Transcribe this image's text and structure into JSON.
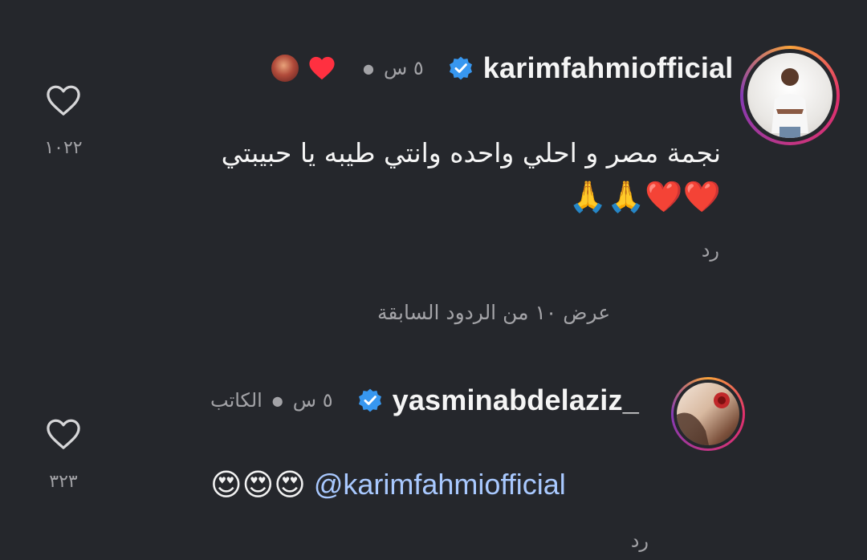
{
  "comments": [
    {
      "username": "karimfahmiofficial",
      "time": "٥ س",
      "text_line1": "نجمة مصر و احلي واحده وانتي طيبه يا حبيبتي",
      "emojis": "❤️❤️🙏🙏",
      "reply_label": "رد",
      "like_count": "١٠٢٢",
      "liked_by_author": true
    },
    {
      "username": "yasminabdelaziz_",
      "time": "٥ س",
      "author_badge": "الكاتب",
      "mention": "@karimfahmiofficial",
      "emojis": "😍😍😍",
      "reply_label": "رد",
      "like_count": "٣٢٣"
    }
  ],
  "view_previous_replies": "عرض ١٠ من الردود السابقة",
  "colors": {
    "background": "#25272c",
    "verified_badge": "#3797f0",
    "heart_red": "#ff3040",
    "mention_link": "#a9c9ff"
  },
  "icons": [
    "heart-outline-icon",
    "verified-badge-icon",
    "red-heart-icon"
  ]
}
